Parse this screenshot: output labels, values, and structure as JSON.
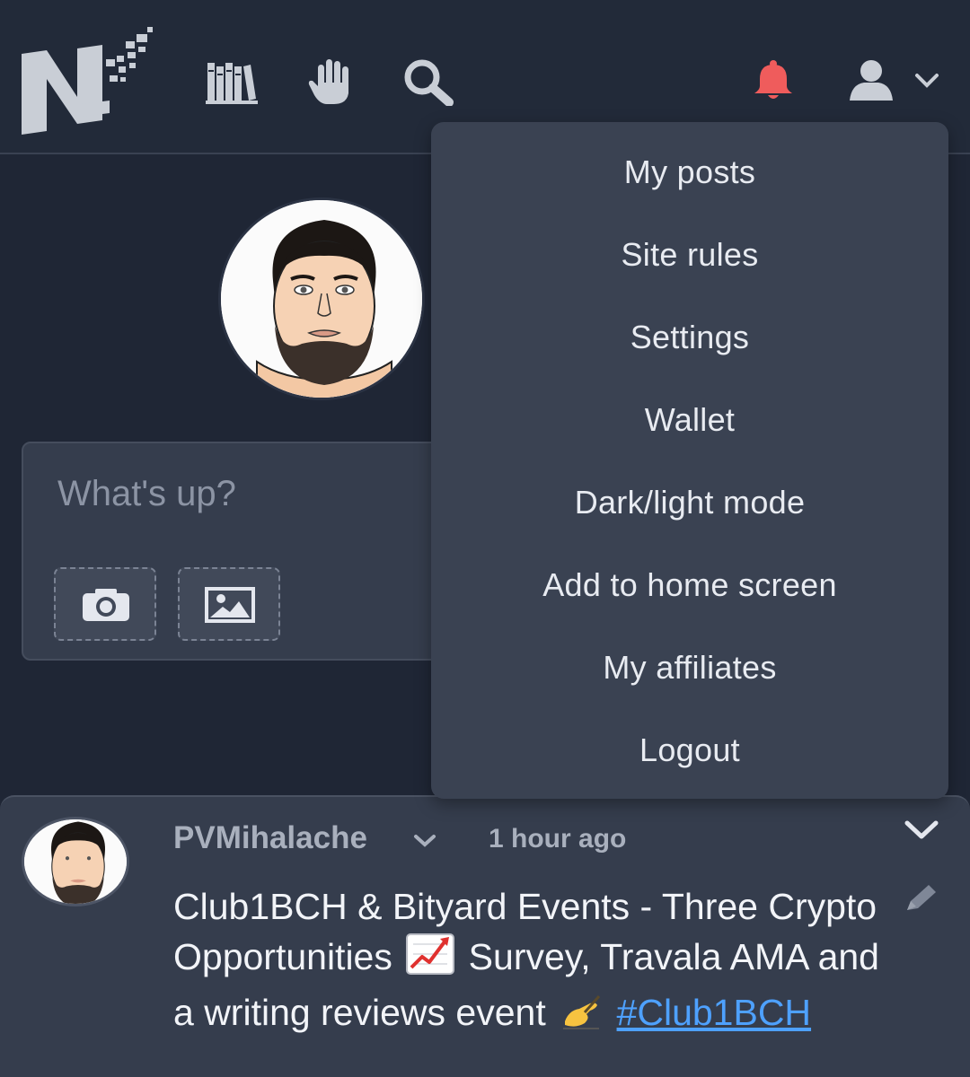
{
  "header": {
    "logo": "nf-logo",
    "icons": {
      "library": "library-icon",
      "hand": "hand-icon",
      "search": "search-icon",
      "notifications": "bell-icon",
      "user": "user-icon",
      "user_menu_chevron": "chevron-down-icon"
    }
  },
  "colors": {
    "background": "#1f2635",
    "card": "#353d4d",
    "dropdown": "#3a4252",
    "bell": "#ef5c5c",
    "link": "#4ea1ff"
  },
  "profile": {
    "avatar": "profile-avatar"
  },
  "composer": {
    "placeholder": "What's up?",
    "camera_icon": "camera-icon",
    "image_icon": "image-icon"
  },
  "user_menu": {
    "items": [
      "My posts",
      "Site rules",
      "Settings",
      "Wallet",
      "Dark/light mode",
      "Add to home screen",
      "My affiliates",
      "Logout"
    ]
  },
  "post": {
    "author": "PVMihalache",
    "time": "1 hour ago",
    "title_part1": "Club1BCH & Bityard Events - Three Crypto Opportunities",
    "title_part2": "Survey, Travala AMA and a writing reviews event",
    "tag": "#Club1BCH",
    "emoji_chart": "chart-increasing-icon",
    "emoji_writing": "writing-hand-icon"
  }
}
